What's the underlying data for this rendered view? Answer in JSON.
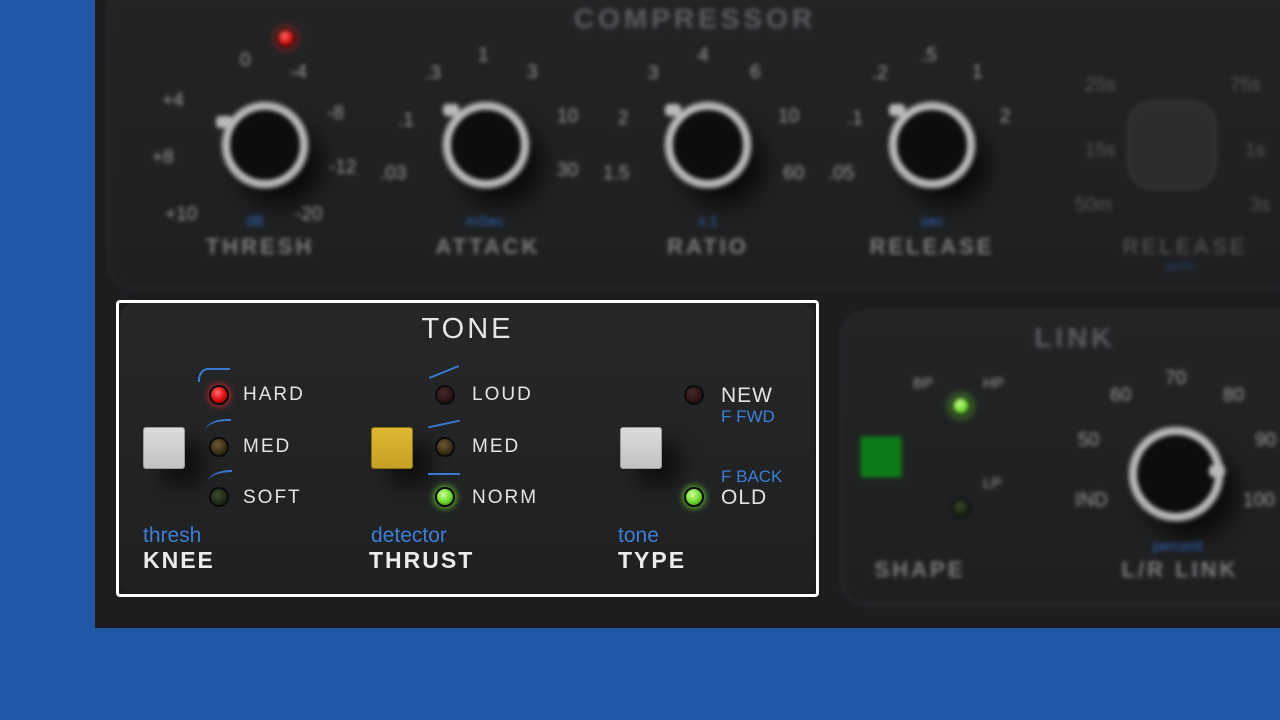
{
  "compressor": {
    "title": "COMPRESSOR",
    "knobs": [
      {
        "label": "THRESH",
        "unit": "dB",
        "ticks": [
          "0",
          "-4",
          "-8",
          "-12",
          "-20",
          "+10",
          "+8",
          "+4"
        ]
      },
      {
        "label": "ATTACK",
        "unit": "mSec",
        "ticks": [
          "1",
          "3",
          "10",
          "30",
          ".03",
          ".1",
          ".3"
        ]
      },
      {
        "label": "RATIO",
        "unit": "x:1",
        "ticks": [
          "4",
          "6",
          "10",
          "60",
          "1.5",
          "2",
          "3"
        ]
      },
      {
        "label": "RELEASE",
        "unit": "sec",
        "ticks": [
          ".5",
          "1",
          "2",
          ".05",
          ".1",
          ".2"
        ]
      },
      {
        "label": "RELEASE",
        "unit": "auto",
        "ticks": [
          "25s",
          "75s",
          "15s",
          "1s",
          "50m",
          "3s"
        ]
      }
    ]
  },
  "tone": {
    "title": "TONE",
    "knee": {
      "options": [
        "HARD",
        "MED",
        "SOFT"
      ],
      "selected": "HARD",
      "sublabel": "thresh",
      "label": "KNEE",
      "button_color": "#d8d8d8"
    },
    "thrust": {
      "options": [
        "LOUD",
        "MED",
        "NORM"
      ],
      "selected": "NORM",
      "sublabel": "detector",
      "label": "THRUST",
      "button_color": "#d6ae2c"
    },
    "type": {
      "new_label": "NEW",
      "new_sub": "F FWD",
      "old_sub": "F BACK",
      "old_label": "OLD",
      "selected": "OLD",
      "sublabel": "tone",
      "label": "TYPE",
      "button_color": "#d8d8d8"
    }
  },
  "link": {
    "title": "LINK",
    "shape": {
      "label": "SHAPE",
      "options": [
        "BP",
        "HP",
        "LP"
      ],
      "selected": "HP"
    },
    "lr_link": {
      "label": "L/R LINK",
      "unit": "percent",
      "ticks": [
        "60",
        "70",
        "80",
        "50",
        "90",
        "IND",
        "100"
      ]
    }
  },
  "colors": {
    "background_blue": "#2158a6",
    "led_red": "#ff2a2a",
    "led_green": "#7eff3a",
    "label_blue": "#3d7fd6",
    "highlight_frame": "#ffffff"
  }
}
